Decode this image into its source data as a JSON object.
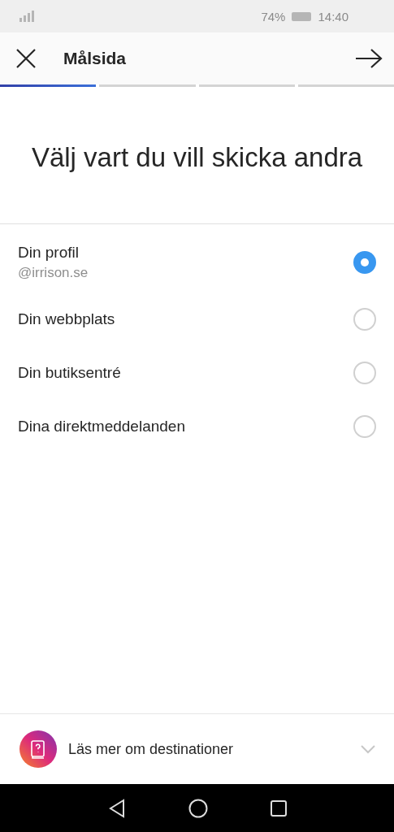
{
  "status_bar": {
    "battery": "74%",
    "time": "14:40"
  },
  "header": {
    "title": "Målsida"
  },
  "steps": [
    {
      "active": true
    },
    {
      "active": false
    },
    {
      "active": false
    },
    {
      "active": false
    }
  ],
  "heading": "Välj vart du vill skicka andra",
  "options": [
    {
      "label": "Din profil",
      "sublabel": "@irrison.se",
      "selected": true
    },
    {
      "label": "Din webbplats",
      "selected": false
    },
    {
      "label": "Din butiksentré",
      "selected": false
    },
    {
      "label": "Dina direktmeddelanden",
      "selected": false
    }
  ],
  "footer": {
    "label": "Läs mer om destinationer"
  }
}
